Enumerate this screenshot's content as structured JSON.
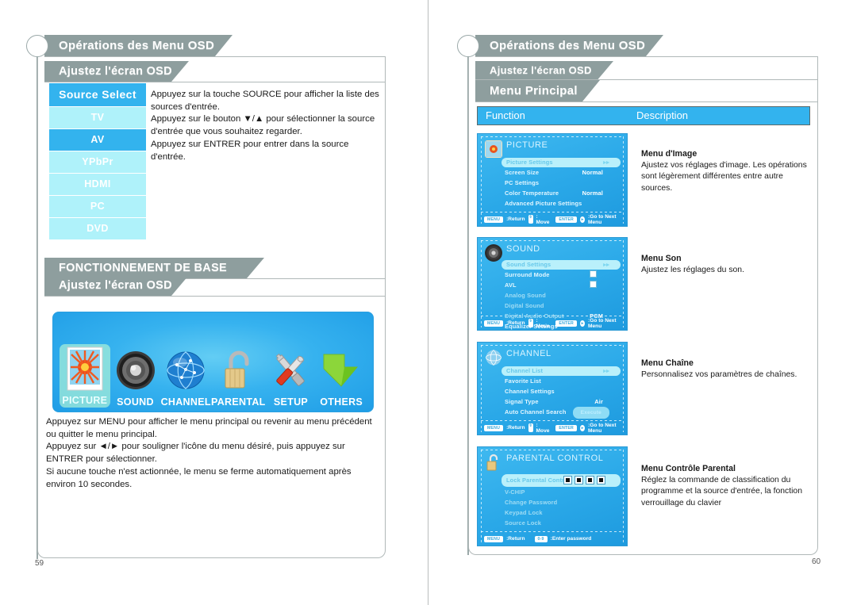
{
  "document": {
    "left_page": {
      "page_number": "59",
      "main_title": "Opérations des Menu OSD",
      "section_title_1": "Ajustez l'écran OSD",
      "source_list": [
        {
          "label": "Source Select",
          "state": "header"
        },
        {
          "label": "TV",
          "state": "normal"
        },
        {
          "label": "AV",
          "state": "selected"
        },
        {
          "label": "YPbPr",
          "state": "normal"
        },
        {
          "label": "HDMI",
          "state": "normal"
        },
        {
          "label": "PC",
          "state": "normal"
        },
        {
          "label": "DVD",
          "state": "normal"
        }
      ],
      "source_description": "Appuyez sur la touche SOURCE pour afficher la liste des sources d'entrée.\nAppuyez sur le bouton ▼/▲ pour sélectionner la source d'entrée que vous souhaitez regarder.\nAppuyez sur ENTRER pour entrer dans la source d'entrée.",
      "section_title_2": "FONCTIONNEMENT DE BASE",
      "section_title_3": "Ajustez l'écran OSD",
      "osd_menu_icons": [
        {
          "caption": "PICTURE",
          "icon": "picture-icon",
          "active": true
        },
        {
          "caption": "SOUND",
          "icon": "speaker-icon",
          "active": false
        },
        {
          "caption": "CHANNEL",
          "icon": "globe-icon",
          "active": false
        },
        {
          "caption": "PARENTAL",
          "icon": "padlock-icon",
          "active": false
        },
        {
          "caption": "SETUP",
          "icon": "tools-icon",
          "active": false
        },
        {
          "caption": "OTHERS",
          "icon": "arrow-icon",
          "active": false
        }
      ],
      "menu_description": "Appuyez sur MENU pour afficher le menu principal ou revenir au menu précédent ou quitter le menu principal.\nAppuyez sur ◄/► pour souligner l'icône du menu désiré, puis appuyez sur ENTRER pour sélectionner.\nSi aucune touche n'est actionnée, le menu se ferme automatiquement après environ 10 secondes."
    },
    "right_page": {
      "page_number": "60",
      "main_title": "Opérations des Menu OSD",
      "section_title_1": "Ajustez l'écran OSD",
      "section_title_2": "Menu Principal",
      "table": {
        "header": {
          "function": "Function",
          "description": "Description"
        },
        "rows": [
          {
            "osd": {
              "title": "PICTURE",
              "icon": "picture-icon",
              "rows": [
                {
                  "label": "Picture Settings",
                  "value": "▸▸",
                  "style": "highlight"
                },
                {
                  "label": "Screen Size",
                  "value": "Normal",
                  "style": "normal"
                },
                {
                  "label": "PC Settings",
                  "value": "",
                  "style": "normal"
                },
                {
                  "label": "Color Temperature",
                  "value": "Normal",
                  "style": "normal"
                },
                {
                  "label": "Advanced Picture Settings",
                  "value": "",
                  "style": "normal"
                }
              ],
              "footer": {
                "key1": "MENU",
                "text1": ":Return",
                "text2": ": Move",
                "key2": "ENTER",
                "key3": "▸",
                "text3": ":Go to Next Menu"
              }
            },
            "title": "Menu d'Image",
            "text": "Ajustez vos réglages d'image. Les opérations sont légèrement différentes entre autre sources."
          },
          {
            "osd": {
              "title": "SOUND",
              "icon": "speaker-icon",
              "rows": [
                {
                  "label": "Sound Settings",
                  "value": "▸▸",
                  "style": "highlight"
                },
                {
                  "label": "Surround Mode",
                  "value": "",
                  "style": "checkbox"
                },
                {
                  "label": "AVL",
                  "value": "",
                  "style": "checkbox"
                },
                {
                  "label": "Analog Sound",
                  "value": "",
                  "style": "dim"
                },
                {
                  "label": "Digital Sound",
                  "value": "",
                  "style": "dim"
                },
                {
                  "label": "Digital Audio Output",
                  "value": "PCM",
                  "style": "dim"
                },
                {
                  "label": "Equalizer Settings",
                  "value": "",
                  "style": "normal"
                }
              ],
              "footer": {
                "key1": "MENU",
                "text1": ":Return",
                "text2": ": Move",
                "key2": "ENTER",
                "key3": "▸",
                "text3": ":Go to Next Menu"
              }
            },
            "title": "Menu Son",
            "text": "Ajustez les réglages du son."
          },
          {
            "osd": {
              "title": "CHANNEL",
              "icon": "globe-icon",
              "rows": [
                {
                  "label": "Channel List",
                  "value": "▸▸",
                  "style": "highlight"
                },
                {
                  "label": "Favorite List",
                  "value": "",
                  "style": "normal"
                },
                {
                  "label": "Channel Settings",
                  "value": "",
                  "style": "normal"
                },
                {
                  "label": "Signal Type",
                  "value": "Air",
                  "style": "normal"
                },
                {
                  "label": "Auto Channel Search",
                  "value": "Execute",
                  "style": "button"
                }
              ],
              "footer": {
                "key1": "MENU",
                "text1": ":Return",
                "text2": ": Move",
                "key2": "ENTER",
                "key3": "▸",
                "text3": ":Go to Next Menu"
              }
            },
            "title": "Menu Chaîne",
            "text": "Personnalisez vos paramètres de chaînes."
          },
          {
            "osd": {
              "title": "PARENTAL CONTROL",
              "icon": "padlock-icon",
              "rows": [
                {
                  "label": "Lock Parental Control",
                  "value": "▪ ▪ ▪ ▪",
                  "style": "highlight-boxes"
                },
                {
                  "label": "V-CHIP",
                  "value": "",
                  "style": "dim"
                },
                {
                  "label": "Change Password",
                  "value": "",
                  "style": "dim"
                },
                {
                  "label": "Keypad Lock",
                  "value": "",
                  "style": "dim"
                },
                {
                  "label": "Source Lock",
                  "value": "",
                  "style": "dim"
                }
              ],
              "footer": {
                "key1": "MENU",
                "text1": ":Return",
                "text2": "",
                "key2": "0-9",
                "key3": "",
                "text3": ":Enter password"
              }
            },
            "title": "Menu Contrôle Parental",
            "text": "Réglez la commande de classification du programme et la source d'entrée, la fonction verrouillage du clavier"
          }
        ]
      }
    }
  },
  "colors": {
    "ribbon": "#8e9e9e",
    "accent_blue": "#33b3ee",
    "light_blue": "#aff2fa",
    "frame_border": "#b0b8b8"
  }
}
